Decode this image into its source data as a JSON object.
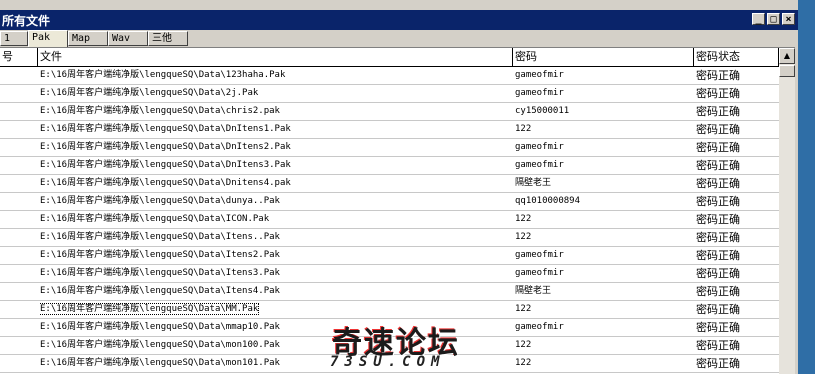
{
  "window": {
    "title": "所有文件",
    "buttons": {
      "minimize": "_",
      "maximize": "□",
      "close": "×"
    }
  },
  "tabs": [
    {
      "label": "1"
    },
    {
      "label": "Pak",
      "active": true
    },
    {
      "label": "Map"
    },
    {
      "label": "Wav"
    },
    {
      "label": "三他"
    }
  ],
  "table": {
    "columns": {
      "index": "号",
      "file": "文件",
      "password": "密码",
      "status": "密码状态"
    },
    "rows": [
      {
        "file": "E:\\16周年客户端纯净版\\lengqueSQ\\Data\\123haha.Pak",
        "password": "gameofmir",
        "status": "密码正确"
      },
      {
        "file": "E:\\16周年客户端纯净版\\lengqueSQ\\Data\\2j.Pak",
        "password": "gameofmir",
        "status": "密码正确"
      },
      {
        "file": "E:\\16周年客户端纯净版\\lengqueSQ\\Data\\chris2.pak",
        "password": "cy15000011",
        "status": "密码正确"
      },
      {
        "file": "E:\\16周年客户端纯净版\\lengqueSQ\\Data\\DnItens1.Pak",
        "password": "122",
        "status": "密码正确"
      },
      {
        "file": "E:\\16周年客户端纯净版\\lengqueSQ\\Data\\DnItens2.Pak",
        "password": "gameofmir",
        "status": "密码正确"
      },
      {
        "file": "E:\\16周年客户端纯净版\\lengqueSQ\\Data\\DnItens3.Pak",
        "password": "gameofmir",
        "status": "密码正确"
      },
      {
        "file": "E:\\16周年客户端纯净版\\lengqueSQ\\Data\\Dnitens4.pak",
        "password": "隔壁老王",
        "status": "密码正确"
      },
      {
        "file": "E:\\16周年客户端纯净版\\lengqueSQ\\Data\\dunya..Pak",
        "password": "qq1010000894",
        "status": "密码正确"
      },
      {
        "file": "E:\\16周年客户端纯净版\\lengqueSQ\\Data\\ICON.Pak",
        "password": "122",
        "status": "密码正确"
      },
      {
        "file": "E:\\16周年客户端纯净版\\lengqueSQ\\Data\\Itens..Pak",
        "password": "122",
        "status": "密码正确"
      },
      {
        "file": "E:\\16周年客户端纯净版\\lengqueSQ\\Data\\Itens2.Pak",
        "password": "gameofmir",
        "status": "密码正确"
      },
      {
        "file": "E:\\16周年客户端纯净版\\lengqueSQ\\Data\\Itens3.Pak",
        "password": "gameofmir",
        "status": "密码正确"
      },
      {
        "file": "E:\\16周年客户端纯净版\\lengqueSQ\\Data\\Itens4.Pak",
        "password": "隔壁老王",
        "status": "密码正确"
      },
      {
        "file": "E:\\16周年客户端纯净版\\lengqueSQ\\Data\\MM.Pak",
        "password": "122",
        "status": "密码正确",
        "focused": true
      },
      {
        "file": "E:\\16周年客户端纯净版\\lengqueSQ\\Data\\mmap10.Pak",
        "password": "gameofmir",
        "status": "密码正确"
      },
      {
        "file": "E:\\16周年客户端纯净版\\lengqueSQ\\Data\\mon100.Pak",
        "password": "122",
        "status": "密码正确"
      },
      {
        "file": "E:\\16周年客户端纯净版\\lengqueSQ\\Data\\mon101.Pak",
        "password": "122",
        "status": "密码正确"
      }
    ]
  },
  "scrollbar": {
    "up_arrow": "▲",
    "down_arrow": "▼"
  },
  "watermark": {
    "title": "奇速论坛",
    "site": "73SU.COM"
  }
}
